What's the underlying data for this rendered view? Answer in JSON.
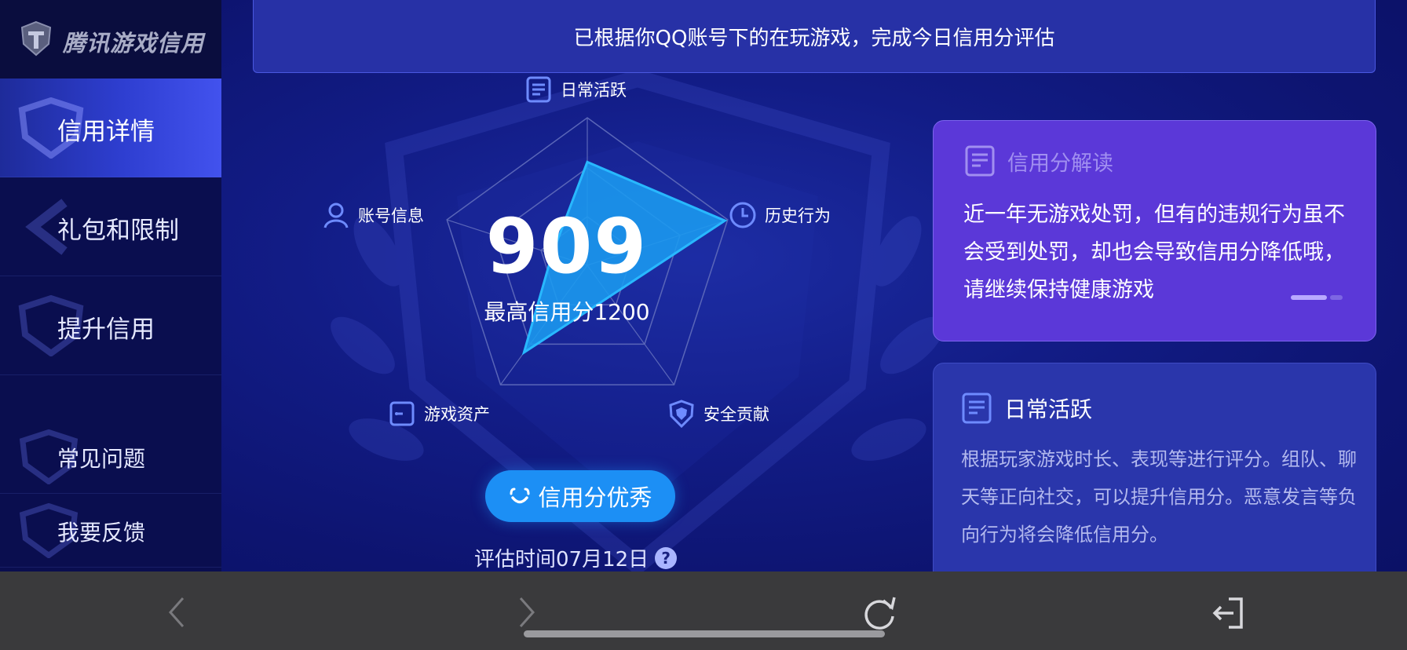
{
  "app": {
    "logo_text": "腾讯游戏信用"
  },
  "sidebar": {
    "items": [
      {
        "label": "信用详情",
        "active": true
      },
      {
        "label": "礼包和限制",
        "active": false
      },
      {
        "label": "提升信用",
        "active": false
      },
      {
        "label": "常见问题",
        "active": false
      },
      {
        "label": "我要反馈",
        "active": false
      }
    ]
  },
  "banner": {
    "text": "已根据你QQ账号下的在玩游戏，完成今日信用分评估"
  },
  "score": {
    "value": "909",
    "max_label": "最高信用分1200",
    "rating": "信用分优秀",
    "eval_time": "评估时间07月12日",
    "help": "?"
  },
  "radar": {
    "axes": [
      {
        "label": "日常活跃",
        "icon": "document-icon",
        "value": 0.7
      },
      {
        "label": "历史行为",
        "icon": "clock-icon",
        "value": 0.98
      },
      {
        "label": "安全贡献",
        "icon": "shield-icon",
        "value": 0.26
      },
      {
        "label": "游戏资产",
        "icon": "wallet-icon",
        "value": 0.73
      },
      {
        "label": "账号信息",
        "icon": "user-icon",
        "value": 0.25
      }
    ],
    "fill_color": "#1a9bf0",
    "stroke_color": "#28b8ff"
  },
  "interpret_card": {
    "title": "信用分解读",
    "body": "近一年无游戏处罚，但有的违规行为虽不会受到处罚，却也会导致信用分降低哦，请继续保持健康游戏"
  },
  "activity_card": {
    "title": "日常活跃",
    "body": "根据玩家游戏时长、表现等进行评分。组队、聊天等正向社交，可以提升信用分。恶意发言等负向行为将会降低信用分。"
  },
  "colors": {
    "sidebar_active": "#3445e0",
    "rating_button": "#1c8ff5",
    "purple_card": "#5b38d8",
    "blue_card": "#2a36ab"
  }
}
